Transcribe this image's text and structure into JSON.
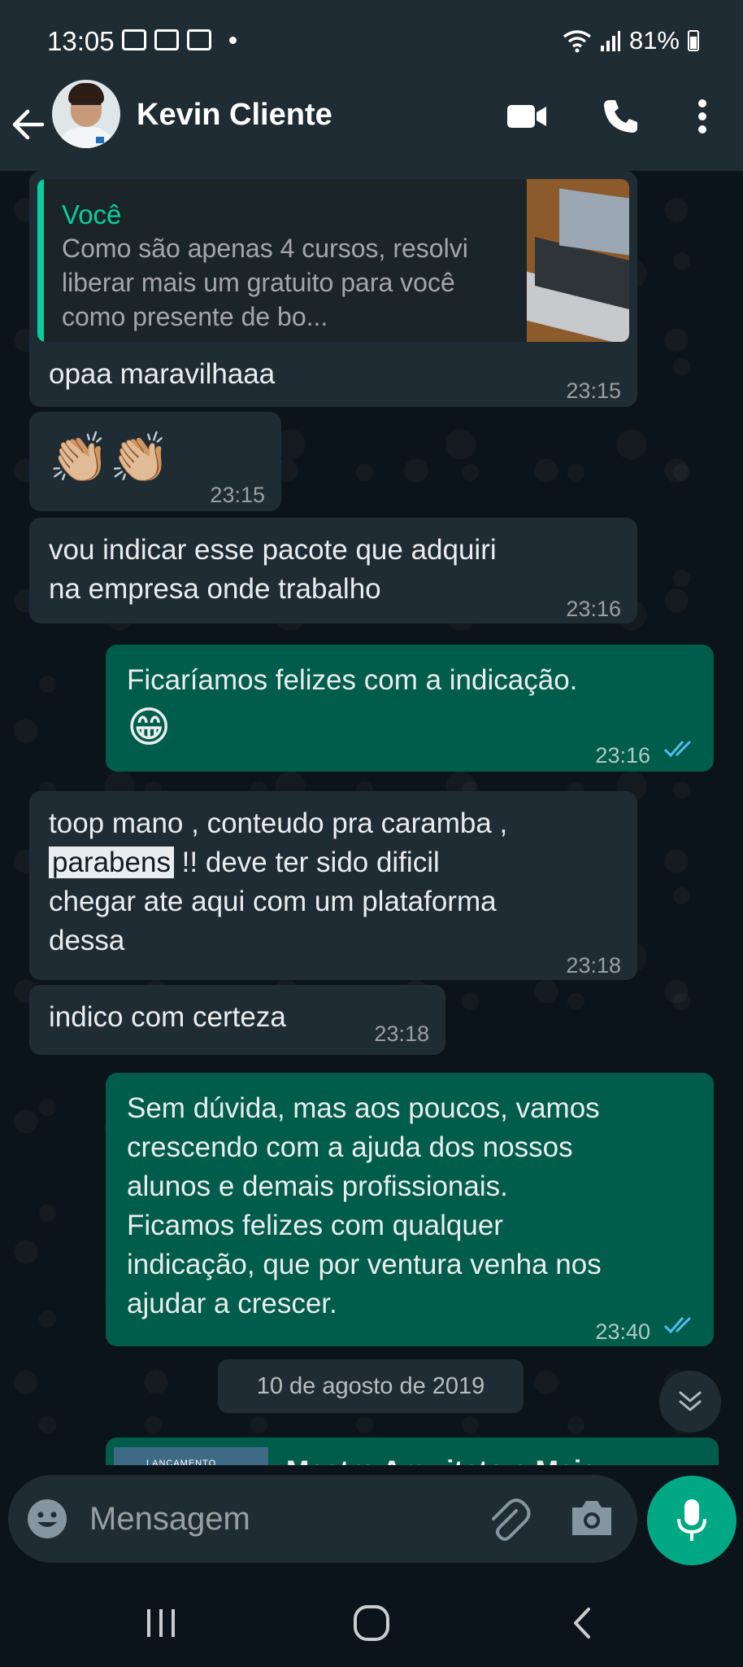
{
  "status_bar": {
    "time": "13:05",
    "battery": "81%"
  },
  "header": {
    "contact_name": "Kevin Cliente"
  },
  "messages": [
    {
      "quote_author": "Você",
      "quote_text": "Como são apenas 4 cursos, resolvi liberar mais um gratuito para você como presente de bo...",
      "text": "opaa maravilhaaa",
      "time": "23:15"
    },
    {
      "text": "👏🏼👏🏼",
      "time": "23:15"
    },
    {
      "text": "vou indicar esse pacote que adquiri\nna empresa onde trabalho",
      "time": "23:16"
    },
    {
      "text": "Ficaríamos felizes com a indicação.",
      "emoji": "😁",
      "time": "23:16"
    },
    {
      "text_before": "toop mano , conteudo pra caramba ,",
      "highlight": "parabens",
      "text_after": " !! deve ter sido dificil\nchegar ate aqui com um plataforma\ndessa",
      "time": "23:18"
    },
    {
      "text": "indico com certeza",
      "time": "23:18"
    },
    {
      "text": "Sem dúvida, mas aos poucos, vamos\ncrescendo com a ajuda dos nossos\nalunos e demais profissionais.\nFicamos felizes com qualquer\nindicação, que por ventura venha nos\najudar a crescer.",
      "time": "23:40"
    }
  ],
  "date_separator": "10 de agosto de 2019",
  "partial_message": {
    "thumb_label": "LANÇAMENTO",
    "title": "Mestre Arquiteto e Mais"
  },
  "input": {
    "placeholder": "Mensagem"
  },
  "colors": {
    "incoming": "#202c33",
    "outgoing": "#005c4b",
    "accent": "#00a884",
    "quote_bar": "#06cf9c",
    "ticks": "#53bdeb"
  }
}
